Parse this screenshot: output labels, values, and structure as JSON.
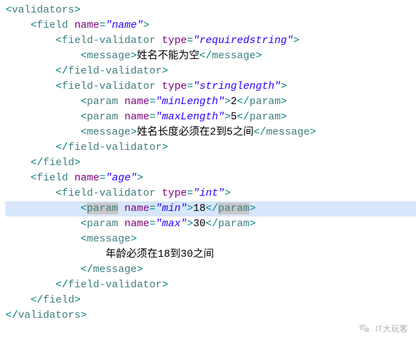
{
  "watermark": {
    "text": "IT大玩客"
  },
  "code": {
    "tags": {
      "validators": "validators",
      "field": "field",
      "fieldValidator": "field-validator",
      "param": "param",
      "message": "message"
    },
    "attrs": {
      "name": "name",
      "type": "type"
    },
    "field1": {
      "name": "\"name\"",
      "v1": {
        "type": "\"requiredstring\"",
        "msg": "姓名不能为空"
      },
      "v2": {
        "type": "\"stringlength\"",
        "p1": {
          "name": "\"minLength\"",
          "val": "2"
        },
        "p2": {
          "name": "\"maxLength\"",
          "val": "5"
        },
        "msg": "姓名长度必须在2到5之间"
      }
    },
    "field2": {
      "name": "\"age\"",
      "v1": {
        "type": "\"int\"",
        "p1": {
          "name": "\"min\"",
          "val": "18"
        },
        "p2": {
          "name": "\"max\"",
          "val": "30"
        },
        "msg": "年龄必须在18到30之间"
      }
    }
  }
}
